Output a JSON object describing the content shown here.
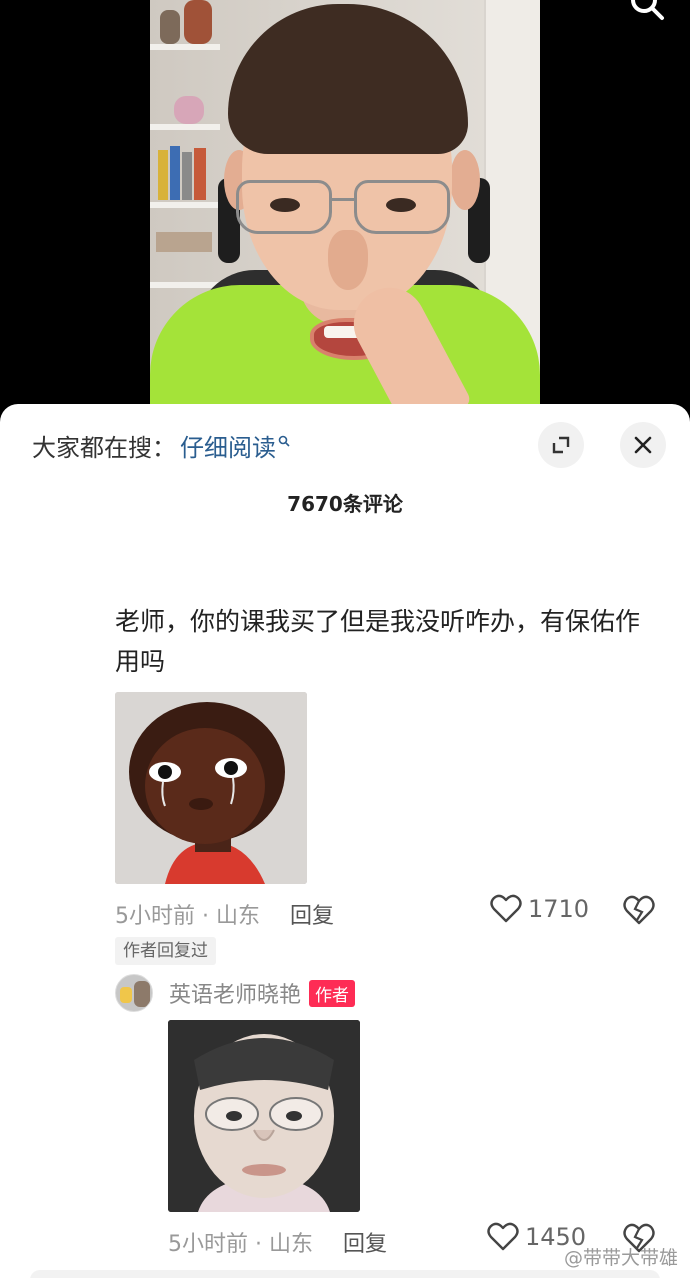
{
  "search": {
    "prefix": "大家都在搜：",
    "term": "仔细阅读"
  },
  "comments_count": "7670条评论",
  "comment": {
    "text": "老师，你的课我买了但是我没听咋办，有保佑作用吗",
    "time": "5小时前 · 山东",
    "reply_label": "回复",
    "likes": "1710",
    "author_replied": "作者回复过"
  },
  "reply": {
    "username": "英语老师晓艳",
    "badge": "作者",
    "time": "5小时前 · 山东",
    "reply_label": "回复",
    "likes": "1450"
  },
  "watermark": "@带带大带雄",
  "colors": {
    "accent_link": "#2a5d8f",
    "author_badge": "#fe2c55"
  }
}
